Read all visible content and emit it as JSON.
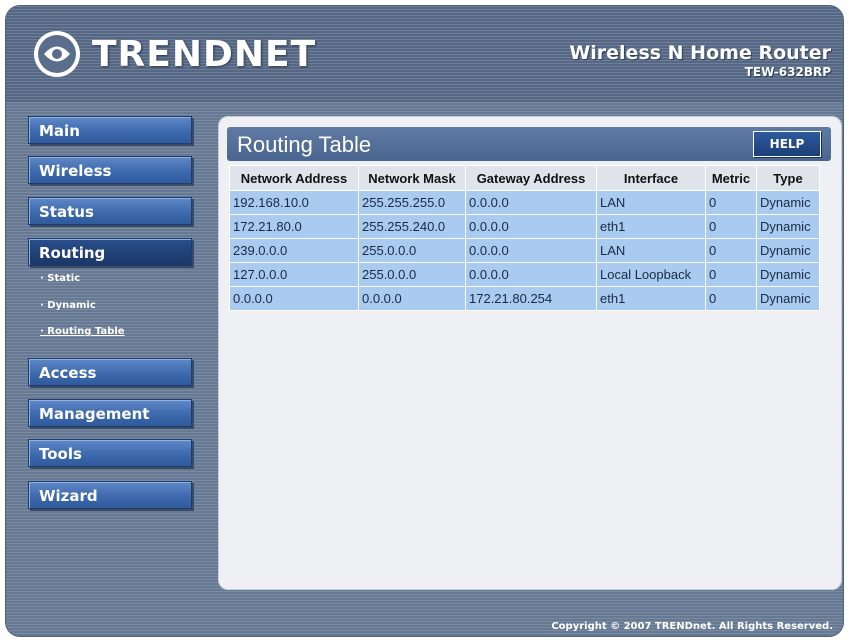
{
  "header": {
    "brand": "TRENDNET",
    "product_name": "Wireless N Home Router",
    "model": "TEW-632BRP"
  },
  "nav": {
    "items": [
      {
        "label": "Main"
      },
      {
        "label": "Wireless"
      },
      {
        "label": "Status"
      },
      {
        "label": "Routing"
      },
      {
        "label": "Access"
      },
      {
        "label": "Management"
      },
      {
        "label": "Tools"
      },
      {
        "label": "Wizard"
      }
    ],
    "routing_sub": [
      {
        "label": "· Static"
      },
      {
        "label": "· Dynamic"
      },
      {
        "label": "· Routing Table"
      }
    ]
  },
  "panel": {
    "title": "Routing Table",
    "help_label": "HELP"
  },
  "table": {
    "headers": [
      "Network Address",
      "Network Mask",
      "Gateway Address",
      "Interface",
      "Metric",
      "Type"
    ],
    "rows": [
      [
        "192.168.10.0",
        "255.255.255.0",
        "0.0.0.0",
        "LAN",
        "0",
        "Dynamic"
      ],
      [
        "172.21.80.0",
        "255.255.240.0",
        "0.0.0.0",
        "eth1",
        "0",
        "Dynamic"
      ],
      [
        "239.0.0.0",
        "255.0.0.0",
        "0.0.0.0",
        "LAN",
        "0",
        "Dynamic"
      ],
      [
        "127.0.0.0",
        "255.0.0.0",
        "0.0.0.0",
        "Local Loopback",
        "0",
        "Dynamic"
      ],
      [
        "0.0.0.0",
        "0.0.0.0",
        "172.21.80.254",
        "eth1",
        "0",
        "Dynamic"
      ]
    ]
  },
  "footer": {
    "copyright": "Copyright © 2007 TRENDnet. All Rights Reserved."
  }
}
